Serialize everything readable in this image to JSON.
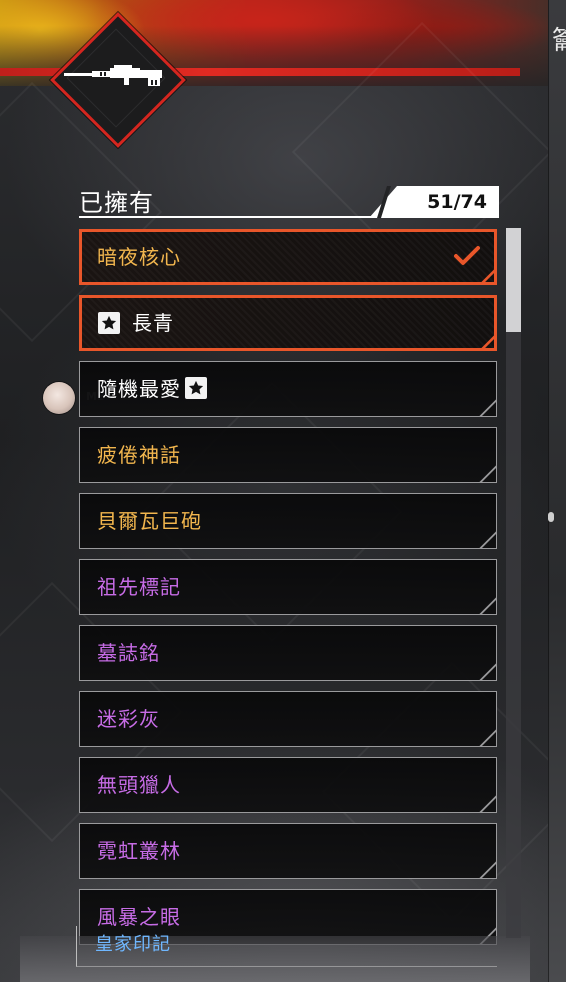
{
  "header": {
    "title": "已擁有",
    "count": "51/74"
  },
  "items": [
    {
      "label": "暗夜核心",
      "color": "#f2b64e",
      "selected": true,
      "checked": true,
      "star_prefix": false,
      "star_suffix": false
    },
    {
      "label": "長青",
      "color": "#ffffff",
      "selected": true,
      "checked": false,
      "star_prefix": true,
      "star_suffix": false
    },
    {
      "label": "隨機最愛",
      "color": "#ffffff",
      "selected": false,
      "checked": false,
      "star_prefix": false,
      "star_suffix": true
    },
    {
      "label": "疲倦神話",
      "color": "#f2b64e",
      "selected": false,
      "checked": false,
      "star_prefix": false,
      "star_suffix": false
    },
    {
      "label": "貝爾瓦巨砲",
      "color": "#f2b64e",
      "selected": false,
      "checked": false,
      "star_prefix": false,
      "star_suffix": false
    },
    {
      "label": "祖先標記",
      "color": "#c76ce6",
      "selected": false,
      "checked": false,
      "star_prefix": false,
      "star_suffix": false
    },
    {
      "label": "墓誌銘",
      "color": "#c76ce6",
      "selected": false,
      "checked": false,
      "star_prefix": false,
      "star_suffix": false
    },
    {
      "label": "迷彩灰",
      "color": "#c76ce6",
      "selected": false,
      "checked": false,
      "star_prefix": false,
      "star_suffix": false
    },
    {
      "label": "無頭獵人",
      "color": "#c76ce6",
      "selected": false,
      "checked": false,
      "star_prefix": false,
      "star_suffix": false
    },
    {
      "label": "霓虹叢林",
      "color": "#c76ce6",
      "selected": false,
      "checked": false,
      "star_prefix": false,
      "star_suffix": false
    },
    {
      "label": "風暴之眼",
      "color": "#c76ce6",
      "selected": false,
      "checked": false,
      "star_prefix": false,
      "star_suffix": false
    }
  ],
  "peek_item": {
    "label": "皇家印記",
    "color": "#6fb7ff"
  },
  "icons": {
    "emblem": "sniper-rifle-icon",
    "favorite": "star-icon",
    "equipped": "checkmark-icon"
  },
  "scroll": {
    "fraction_visible": 0.15,
    "position": 0.0
  },
  "colors": {
    "accent": "#e8562a",
    "legendary": "#f2b64e",
    "epic": "#c76ce6",
    "rare": "#6fb7ff",
    "emblem_border": "#d4261f"
  },
  "right_edge_glyph": "籥"
}
